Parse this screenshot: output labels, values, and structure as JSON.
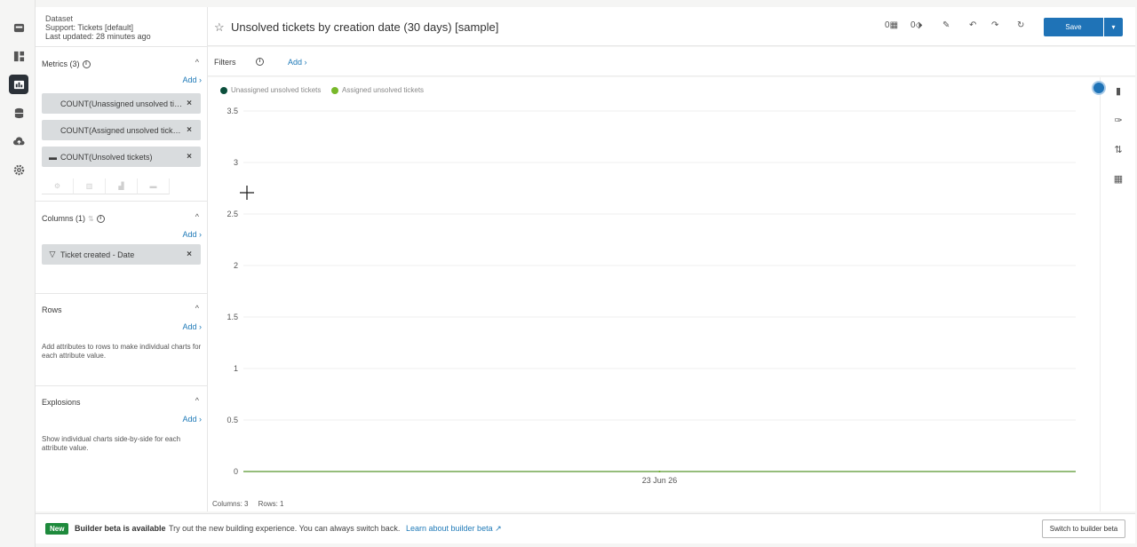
{
  "dataset": {
    "label": "Dataset",
    "name": "Support: Tickets [default]",
    "updated": "Last updated: 28 minutes ago"
  },
  "metrics": {
    "title": "Metrics (3)",
    "add": "Add ›",
    "items": [
      {
        "label": "COUNT(Unassigned unsolved tickets)"
      },
      {
        "label": "COUNT(Assigned unsolved tickets)"
      },
      {
        "label": "COUNT(Unsolved tickets)"
      }
    ]
  },
  "columns": {
    "title": "Columns (1)",
    "add": "Add ›",
    "items": [
      {
        "label": "Ticket created - Date"
      }
    ]
  },
  "rows": {
    "title": "Rows",
    "add": "Add ›",
    "help": "Add attributes to rows to make individual charts for each attribute value."
  },
  "explosions": {
    "title": "Explosions",
    "add": "Add ›",
    "help": "Show individual charts side-by-side for each attribute value."
  },
  "header": {
    "title": "Unsolved tickets by creation date (30 days) [sample]",
    "save": "Save",
    "count_a": "0",
    "count_b": "0"
  },
  "filters": {
    "label": "Filters",
    "add": "Add ›"
  },
  "chart_data": {
    "type": "line",
    "x": [
      "23 Jun 26"
    ],
    "series": [
      {
        "name": "Unassigned unsolved tickets",
        "color": "#0b4f3c",
        "values": [
          0
        ]
      },
      {
        "name": "Assigned unsolved tickets",
        "color": "#78b82a",
        "values": [
          0
        ]
      }
    ],
    "yticks": [
      "0",
      "0.5",
      "1",
      "1.5",
      "2",
      "2.5",
      "3",
      "3.5"
    ],
    "ylim": [
      0,
      3.5
    ],
    "legend": "top-left",
    "grid": true
  },
  "footer": {
    "columns": "Columns: 3",
    "rows": "Rows: 1"
  },
  "banner": {
    "badge": "New",
    "title": "Builder beta is available",
    "text": "Try out the new building experience. You can always switch back.",
    "link": "Learn about builder beta ↗",
    "switch": "Switch to builder beta"
  },
  "colors": {
    "accent": "#1f73b7",
    "badge": "#1e8a3c",
    "rail_active": "#2b3138"
  }
}
